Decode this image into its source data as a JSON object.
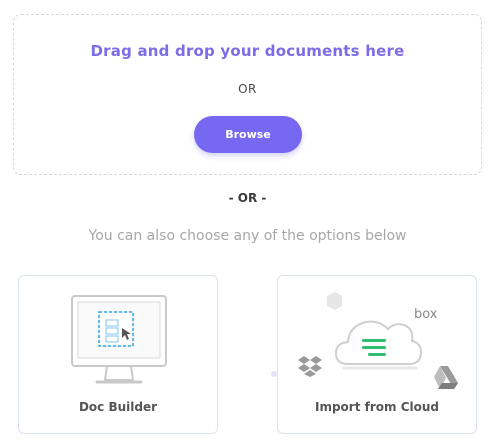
{
  "dropzone": {
    "title": "Drag and drop your documents here",
    "or_text": "OR",
    "browse_label": "Browse"
  },
  "divider_text": "- OR -",
  "subtitle": "You can also choose any of the options below",
  "options": [
    {
      "label": "Doc Builder",
      "icon": "desktop-doc-builder-icon"
    },
    {
      "label": "Import from Cloud",
      "icon": "cloud-import-icon"
    }
  ],
  "cloud_brands": {
    "box": "box"
  },
  "colors": {
    "accent": "#7668f1",
    "title_purple": "#7b6ce7",
    "cloud_green": "#2fbf71",
    "doc_blue": "#2ba8e8"
  }
}
